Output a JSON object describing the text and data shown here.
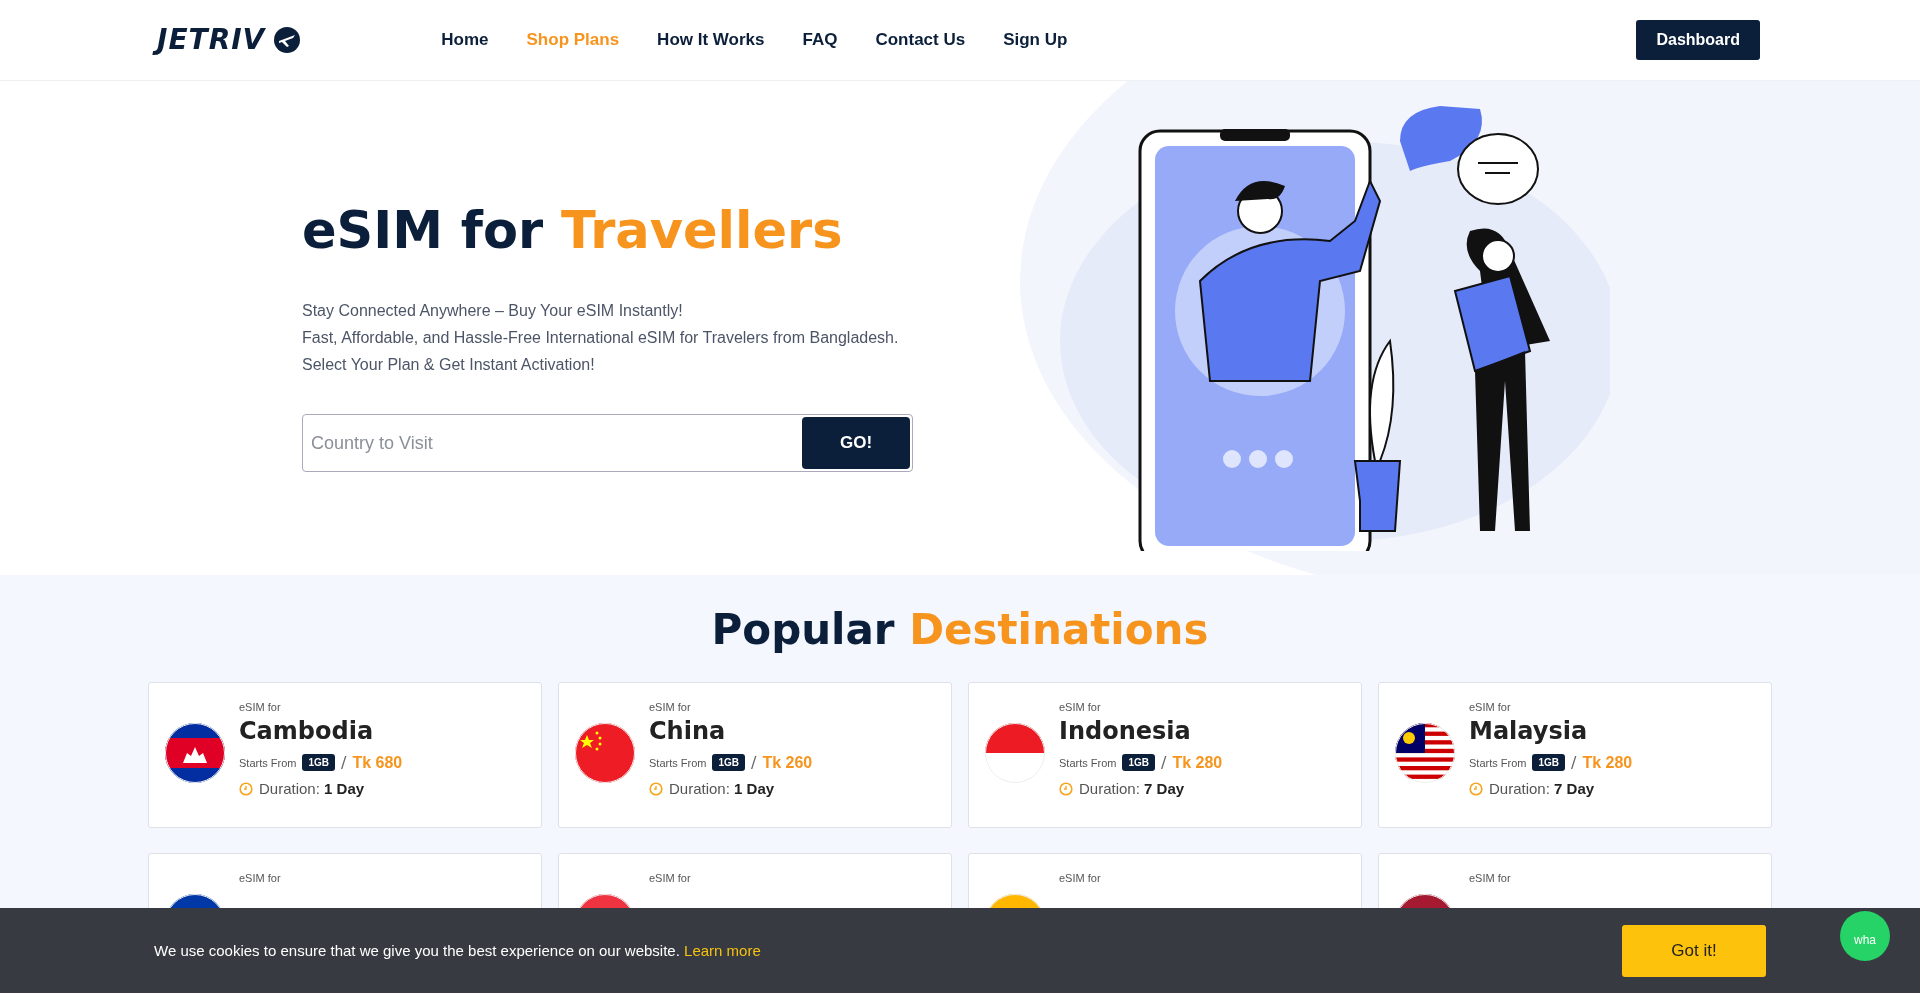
{
  "header": {
    "logo": "JETRIV",
    "nav": [
      {
        "label": "Home",
        "selected": false
      },
      {
        "label": "Shop Plans",
        "selected": true
      },
      {
        "label": "How It Works",
        "selected": false
      },
      {
        "label": "FAQ",
        "selected": false
      },
      {
        "label": "Contact Us",
        "selected": false
      },
      {
        "label": "Sign Up",
        "selected": false
      }
    ],
    "dashboard_button": "Dashboard"
  },
  "hero": {
    "title": "eSIM for",
    "title_highlight": "Travellers",
    "lines": [
      "Stay Connected Anywhere – Buy Your eSIM Instantly!",
      "Fast, Affordable, and Hassle-Free International eSIM for Travelers from Bangladesh.",
      "Select Your Plan & Get Instant Activation!"
    ],
    "search": {
      "placeholder": "Country to Visit",
      "button": "GO!"
    }
  },
  "destinations": {
    "title": "Popular",
    "title_highlight": "Destinations",
    "cards": [
      {
        "prefix": "eSIM for",
        "country": "Cambodia",
        "starts_label": "Starts From",
        "data": "1GB",
        "separator": "/",
        "price": "Tk 680",
        "duration_label": "Duration:",
        "duration": "1 Day"
      },
      {
        "prefix": "eSIM for",
        "country": "China",
        "starts_label": "Starts From",
        "data": "1GB",
        "separator": "/",
        "price": "Tk 260",
        "duration_label": "Duration:",
        "duration": "1 Day"
      },
      {
        "prefix": "eSIM for",
        "country": "Indonesia",
        "starts_label": "Starts From",
        "data": "1GB",
        "separator": "/",
        "price": "Tk 280",
        "duration_label": "Duration:",
        "duration": "7 Day"
      },
      {
        "prefix": "eSIM for",
        "country": "Malaysia",
        "starts_label": "Starts From",
        "data": "1GB",
        "separator": "/",
        "price": "Tk 280",
        "duration_label": "Duration:",
        "duration": "7 Day"
      },
      {
        "prefix": "eSIM for"
      },
      {
        "prefix": "eSIM for"
      },
      {
        "prefix": "eSIM for"
      },
      {
        "prefix": "eSIM for"
      }
    ]
  },
  "cookie_bar": {
    "text": "We use cookies to ensure that we give you the best experience on our website.",
    "link": "Learn more",
    "button": "Got it!"
  },
  "chat_button": {
    "label": "wha"
  }
}
